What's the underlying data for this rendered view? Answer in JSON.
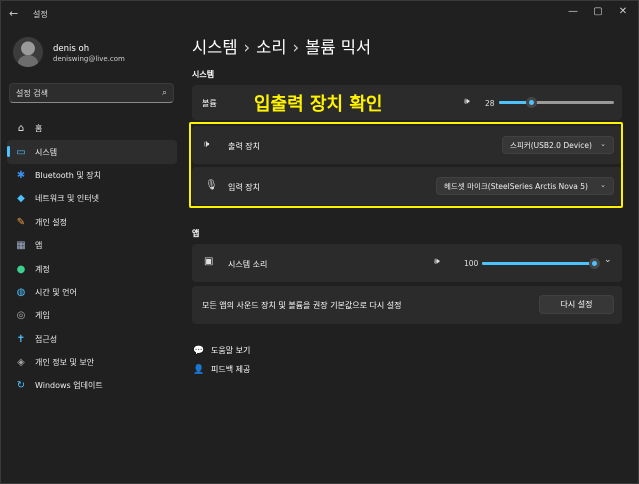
{
  "window": {
    "app_title": "설정",
    "controls": {
      "minimize": "—",
      "maximize": "▢",
      "close": "✕"
    }
  },
  "profile": {
    "name": "denis oh",
    "email": "deniswing@live.com"
  },
  "search": {
    "placeholder": "설정 검색",
    "value": ""
  },
  "sidebar": {
    "items": [
      {
        "label": "홈",
        "icon": "home-icon",
        "glyph": "⌂",
        "color": "#e8e8e8",
        "active": false
      },
      {
        "label": "시스템",
        "icon": "system-icon",
        "glyph": "▭",
        "color": "#4cc2ff",
        "active": true
      },
      {
        "label": "Bluetooth 및 장치",
        "icon": "bluetooth-icon",
        "glyph": "✱",
        "color": "#3a8eea",
        "active": false
      },
      {
        "label": "네트워크 및 인터넷",
        "icon": "wifi-icon",
        "glyph": "◆",
        "color": "#4cc2ff",
        "active": false
      },
      {
        "label": "개인 설정",
        "icon": "brush-icon",
        "glyph": "✎",
        "color": "#f0a040",
        "active": false
      },
      {
        "label": "앱",
        "icon": "apps-icon",
        "glyph": "▦",
        "color": "#a0b0c8",
        "active": false
      },
      {
        "label": "계정",
        "icon": "account-icon",
        "glyph": "●",
        "color": "#3ccf8e",
        "active": false
      },
      {
        "label": "시간 및 언어",
        "icon": "globe-icon",
        "glyph": "◍",
        "color": "#4cc2ff",
        "active": false
      },
      {
        "label": "게임",
        "icon": "gamepad-icon",
        "glyph": "◎",
        "color": "#b0b0b0",
        "active": false
      },
      {
        "label": "접근성",
        "icon": "accessibility-icon",
        "glyph": "✝",
        "color": "#4cc2ff",
        "active": false
      },
      {
        "label": "개인 정보 및 보안",
        "icon": "shield-icon",
        "glyph": "◈",
        "color": "#a0a0a0",
        "active": false
      },
      {
        "label": "Windows 업데이트",
        "icon": "update-icon",
        "glyph": "↻",
        "color": "#4cc2ff",
        "active": false
      }
    ]
  },
  "breadcrumb": {
    "parts": [
      "시스템",
      "소리",
      "볼륨 믹서"
    ],
    "separator": "›"
  },
  "system_section": {
    "title": "시스템",
    "volume_label": "볼륨",
    "volume_value": "28",
    "volume_level": 28,
    "output": {
      "label": "출력 장치",
      "selected": "스피커(USB2.0 Device)"
    },
    "input": {
      "label": "입력 장치",
      "selected": "헤드셋 마이크(SteelSeries Arctis Nova 5)"
    }
  },
  "annotation": {
    "text": "입출력 장치 확인",
    "color": "#fff200"
  },
  "apps_section": {
    "title": "앱",
    "system_sounds_label": "시스템 소리",
    "system_sounds_value": "100",
    "system_sounds_level": 100,
    "reset_text": "모든 앱의 사운드 장치 및 볼륨을 권장 기본값으로 다시 설정",
    "reset_button": "다시 설정"
  },
  "links": {
    "help": "도움말 보기",
    "feedback": "피드백 제공"
  },
  "colors": {
    "accent": "#4cc2ff",
    "background": "#202020",
    "card": "#2b2b2b"
  }
}
